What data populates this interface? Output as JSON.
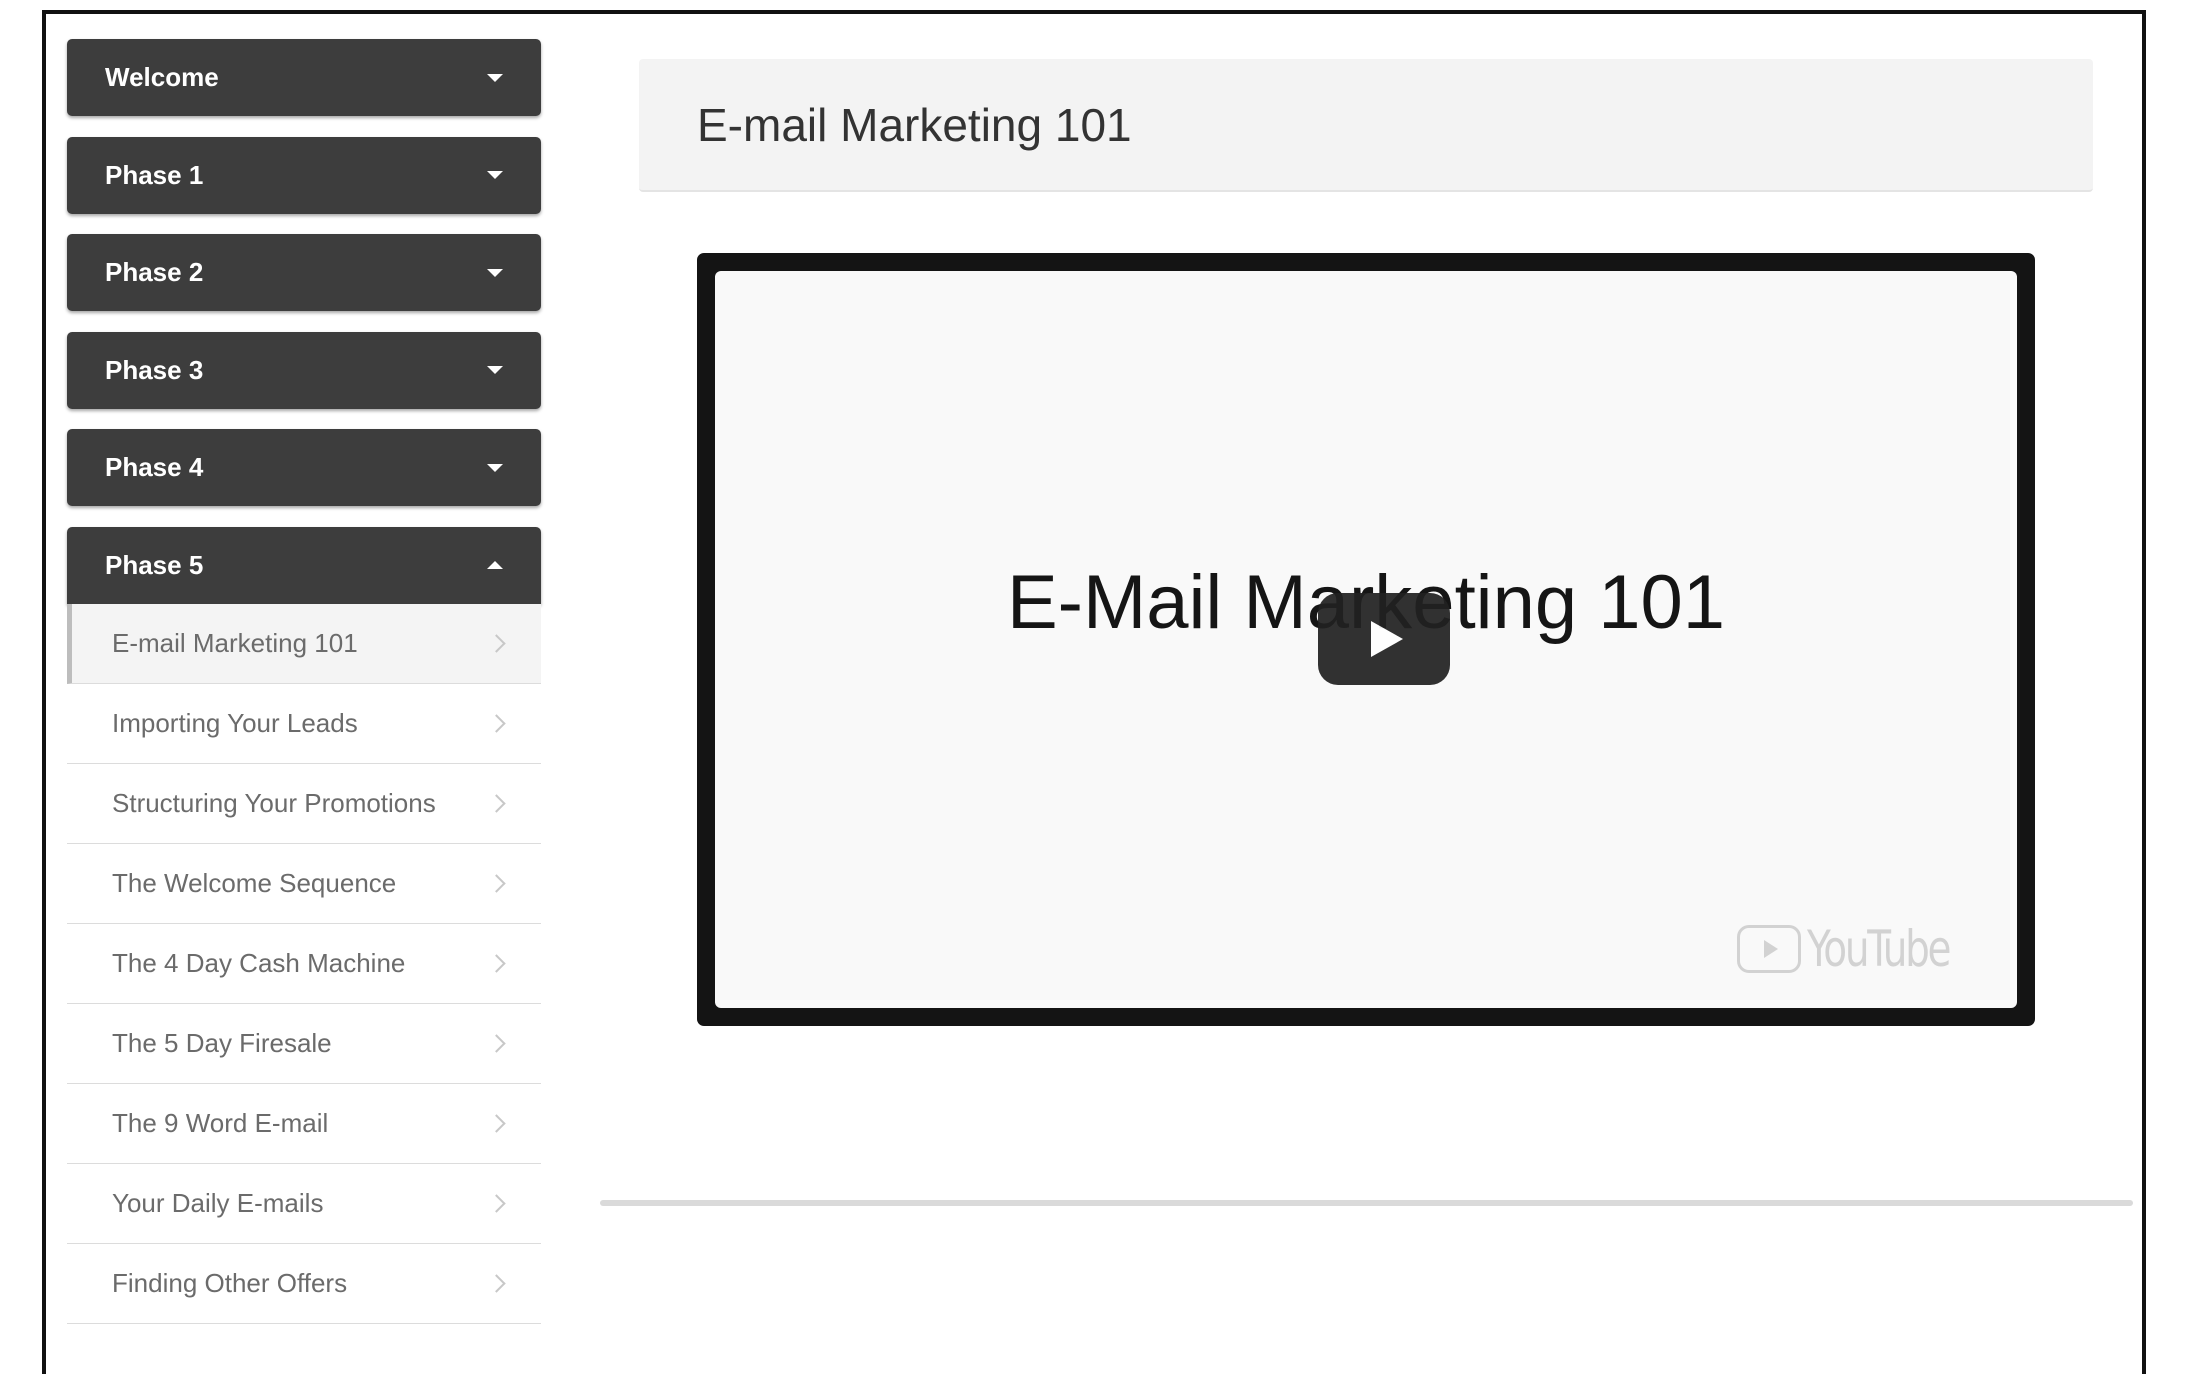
{
  "sidebar": {
    "phases": [
      {
        "label": "Welcome"
      },
      {
        "label": "Phase 1"
      },
      {
        "label": "Phase 2"
      },
      {
        "label": "Phase 3"
      },
      {
        "label": "Phase 4"
      },
      {
        "label": "Phase 5"
      }
    ],
    "open_phase_lessons": [
      {
        "label": "E-mail Marketing 101",
        "active": true
      },
      {
        "label": "Importing Your Leads"
      },
      {
        "label": "Structuring Your Promotions"
      },
      {
        "label": "The Welcome Sequence"
      },
      {
        "label": "The 4 Day Cash Machine"
      },
      {
        "label": "The 5 Day Firesale"
      },
      {
        "label": "The 9 Word E-mail"
      },
      {
        "label": "Your Daily E-mails"
      },
      {
        "label": "Finding Other Offers"
      }
    ]
  },
  "main": {
    "title": "E-mail Marketing 101",
    "video": {
      "heading": "E-Mail Marketing 101",
      "provider_logo": "YouTube",
      "play_icon": "play-icon"
    }
  },
  "colors": {
    "phase_bg": "#3d3d3d",
    "phase_text": "#ffffff",
    "lesson_text": "#6b6b6b",
    "title_bar_bg": "#f3f3f3",
    "video_frame": "#141414"
  }
}
